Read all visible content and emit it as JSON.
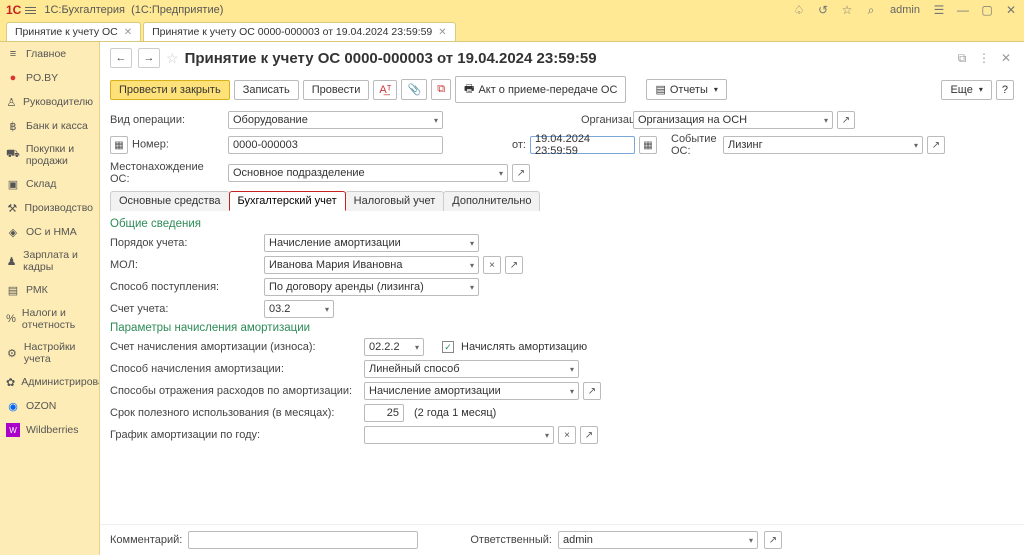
{
  "titlebar": {
    "app": "1С:Бухгалтерия",
    "edition": "(1С:Предприятие)",
    "user": "admin"
  },
  "tabs": {
    "t1": "Принятие к учету ОС",
    "t2": "Принятие к учету ОС 0000-000003 от 19.04.2024 23:59:59"
  },
  "sidebar": {
    "main": "Главное",
    "poby": "PO.BY",
    "ruk": "Руководителю",
    "bank": "Банк и касса",
    "pokup": "Покупки и продажи",
    "sklad": "Склад",
    "proizv": "Производство",
    "osnma": "ОС и НМА",
    "zarp": "Зарплата и кадры",
    "pmk": "РМК",
    "nalog": "Налоги и отчетность",
    "nastr": "Настройки учета",
    "admin": "Администрирование",
    "ozon": "OZON",
    "wb": "Wildberries"
  },
  "doc": {
    "title": "Принятие к учету ОС 0000-000003 от 19.04.2024 23:59:59"
  },
  "tb": {
    "post_close": "Провести и закрыть",
    "save": "Записать",
    "post": "Провести",
    "akt": "Акт о приеме-передаче ОС",
    "reports": "Отчеты",
    "more": "Еще"
  },
  "hdr": {
    "op_lbl": "Вид операции:",
    "op_val": "Оборудование",
    "org_lbl": "Организация:",
    "org_val": "Организация на ОСН",
    "num_lbl": "Номер:",
    "num_val": "0000-000003",
    "ot": "от:",
    "date_val": "19.04.2024 23:59:59",
    "event_lbl": "Событие ОС:",
    "event_val": "Лизинг",
    "loc_lbl": "Местонахождение ОС:",
    "loc_val": "Основное подразделение"
  },
  "tabs2": {
    "t1": "Основные средства",
    "t2": "Бухгалтерский учет",
    "t3": "Налоговый учет",
    "t4": "Дополнительно"
  },
  "sec1": {
    "h": "Общие сведения",
    "poryadok_lbl": "Порядок учета:",
    "poryadok_val": "Начисление амортизации",
    "mol_lbl": "МОЛ:",
    "mol_val": "Иванова Мария Ивановна",
    "sposob_lbl": "Способ поступления:",
    "sposob_val": "По договору аренды (лизинга)",
    "schet_lbl": "Счет учета:",
    "schet_val": "03.2"
  },
  "sec2": {
    "h": "Параметры начисления амортизации",
    "schet_am_lbl": "Счет начисления амортизации (износа):",
    "schet_am_val": "02.2.2",
    "nachisl_cb": "Начислять амортизацию",
    "sposob_am_lbl": "Способ начисления амортизации:",
    "sposob_am_val": "Линейный способ",
    "sposob_rash_lbl": "Способы отражения расходов по амортизации:",
    "sposob_rash_val": "Начисление амортизации",
    "srok_lbl": "Срок полезного использования (в месяцах):",
    "srok_val": "25",
    "srok_txt": "(2 года 1 месяц)",
    "grafik_lbl": "График амортизации по году:"
  },
  "bottom": {
    "comment_lbl": "Комментарий:",
    "resp_lbl": "Ответственный:",
    "resp_val": "admin"
  }
}
